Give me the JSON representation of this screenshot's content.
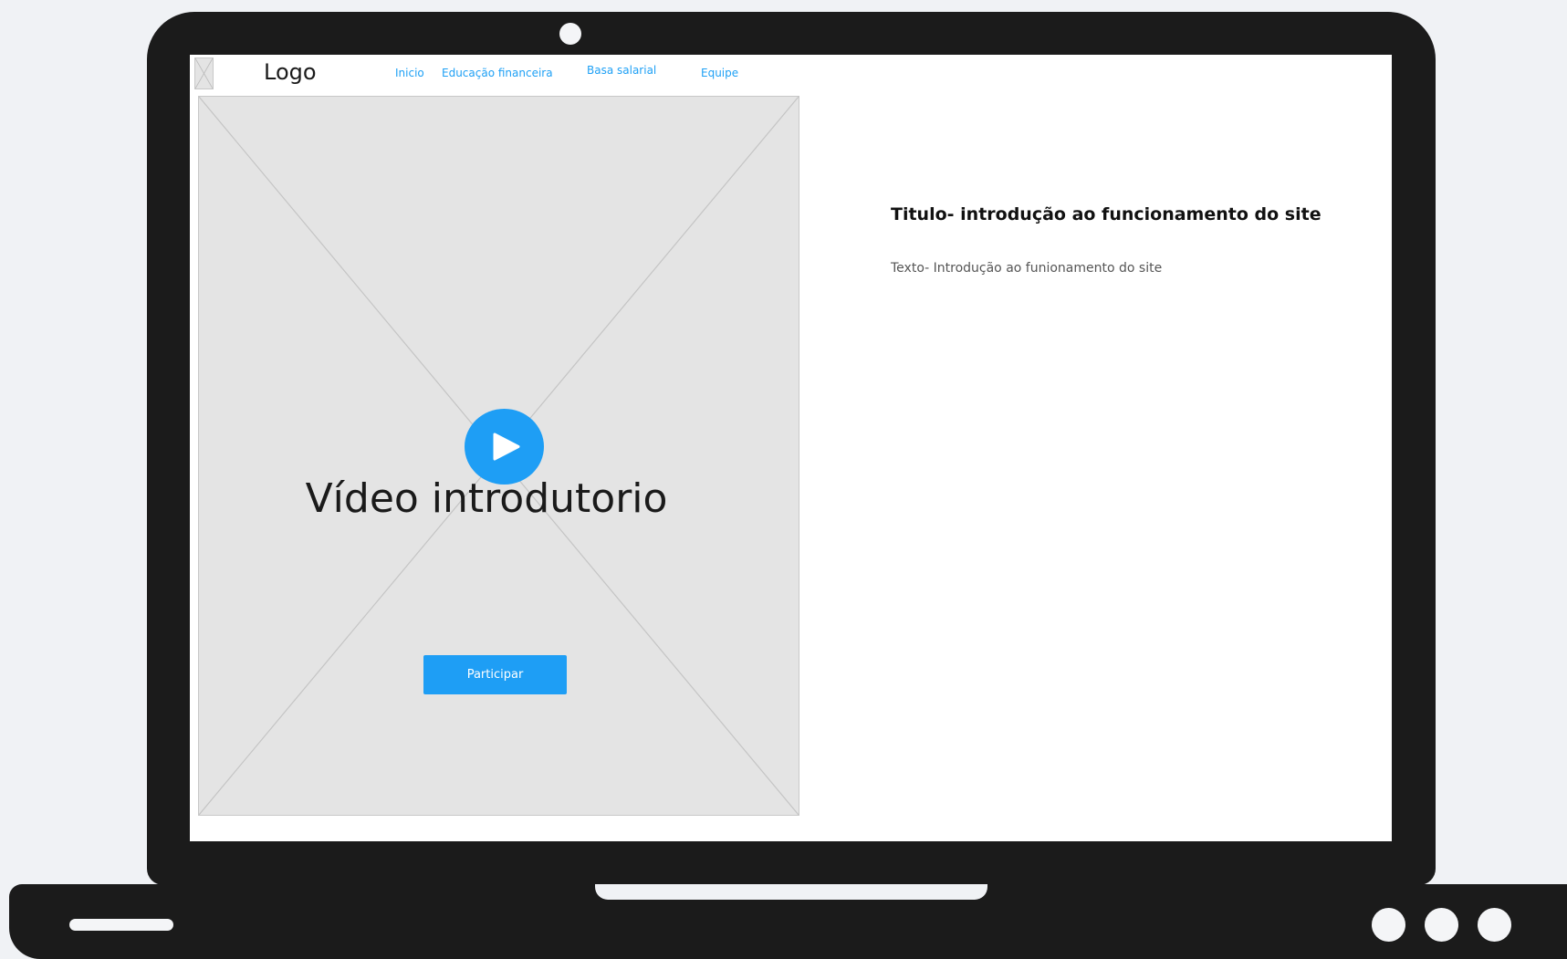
{
  "header": {
    "logo_label": "Logo",
    "nav": [
      {
        "label": "Inicio"
      },
      {
        "label": "Educação financeira"
      },
      {
        "label": "Basa salarial"
      },
      {
        "label": "Equipe"
      }
    ]
  },
  "hero": {
    "video_title": "Vídeo introdutorio",
    "cta_label": "Participar"
  },
  "intro": {
    "title": "Titulo- introdução ao funcionamento do site",
    "text": "Texto-  Introdução ao funionamento do site"
  },
  "colors": {
    "accent": "#1e9ef5",
    "frame": "#1b1b1b",
    "placeholder": "#e4e4e4",
    "background": "#f0f2f5"
  },
  "icons": {
    "play": "play-icon",
    "image_placeholder": "image-placeholder-icon"
  }
}
